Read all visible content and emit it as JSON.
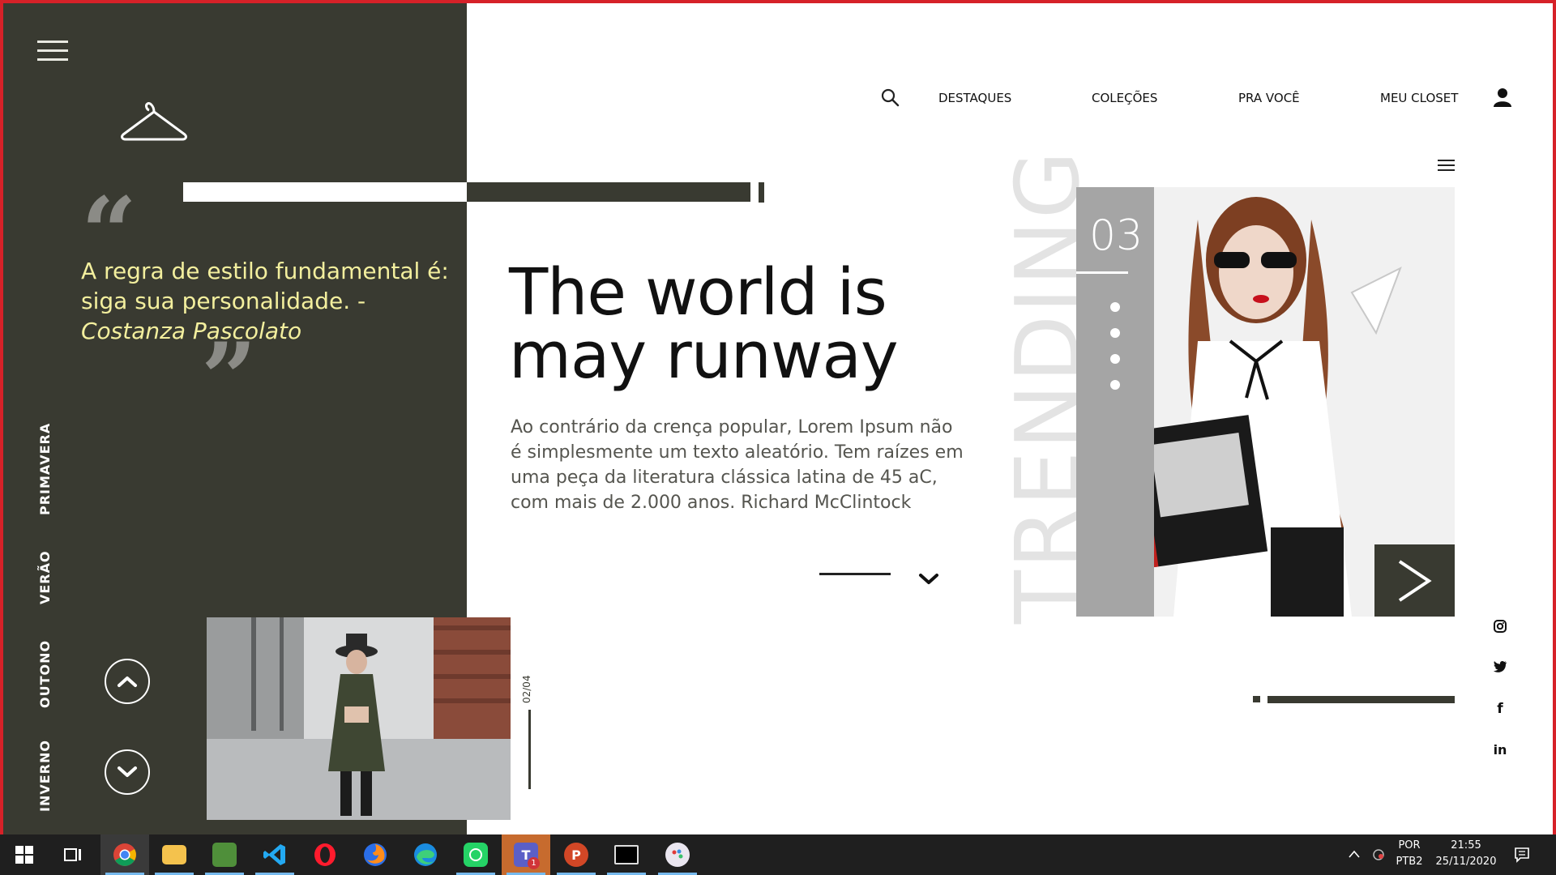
{
  "nav": {
    "items": [
      "DESTAQUES",
      "COLEÇÕES",
      "PRA VOCÊ",
      "MEU CLOSET"
    ],
    "search_icon": "search-icon",
    "user_icon": "user-icon"
  },
  "sidebar": {
    "menu_icon": "hamburger-icon",
    "logo_icon": "hanger-icon",
    "quote": {
      "open_mark": "“",
      "text": "A regra de estilo fundamental é: siga sua personalidade. - ",
      "author": "Costanza Pascolato",
      "close_mark": "”"
    },
    "seasons": [
      "PRIMAVERA",
      "VERÃO",
      "OUTONO",
      "INVERNO"
    ],
    "up_icon": "chevron-up-icon",
    "down_icon": "chevron-down-icon",
    "slide_counter": "02/04"
  },
  "hero": {
    "title": "The world is may runway",
    "description": "Ao contrário da crença popular, Lorem Ipsum não é simplesmente um texto aleatório. Tem raízes em uma peça da literatura clássica latina de 45 aC, com mais de 2.000 anos. Richard McClintock"
  },
  "trending": {
    "label": "TRENDING",
    "number": "03",
    "dots": 4,
    "next_icon": "chevron-right-icon"
  },
  "social": [
    "instagram-icon",
    "twitter-icon",
    "facebook-icon",
    "linkedin-icon"
  ],
  "taskbar": {
    "apps": [
      "chrome",
      "task-view",
      "file-explorer",
      "image-editor",
      "vscode",
      "opera",
      "firefox",
      "edge",
      "whatsapp",
      "teams",
      "powerpoint",
      "terminal",
      "paint"
    ],
    "teams_badge": "1",
    "language_top": "POR",
    "language_bottom": "PTB2",
    "time": "21:55",
    "date": "25/11/2020"
  },
  "colors": {
    "panel": "#393a31",
    "quote_text": "#f3ef9e",
    "frame": "#d62128"
  }
}
